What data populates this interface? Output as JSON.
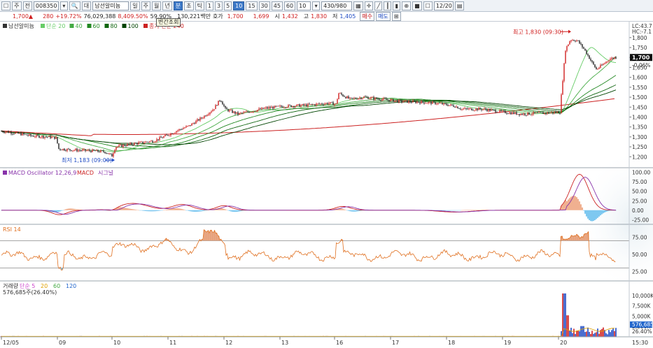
{
  "toolbar": {
    "items": [
      "주",
      "전",
      "대",
      "남선알미늄",
      "일",
      "주",
      "월",
      "년",
      "분",
      "초",
      "틱",
      "1",
      "3",
      "5",
      "10",
      "15",
      "30",
      "45",
      "60",
      "10",
      "430/980",
      "12/20"
    ],
    "active_index": 14
  },
  "ticker_code": "008350",
  "quote": {
    "price": "1,700▲",
    "change": "280",
    "change_pct": "+19.72%",
    "volume": "76,029,388",
    "vol_ratio": "8,409.50%",
    "turnover_ratio": "59.90%",
    "amount": "130,221백만",
    "bid_label": "호가",
    "bid": "1,700",
    "ask": "1,699",
    "open_label": "시",
    "open": "1,432",
    "high_label": "고",
    "high": "1,830",
    "low_label": "저",
    "low": "1,405",
    "buy_btn": "매수",
    "sell_btn": "매도"
  },
  "tooltip": "변간조회",
  "price_panel": {
    "legend": [
      "남선알미늄",
      "단순 20",
      "40",
      "60",
      "80",
      "100",
      "종가 단순 240"
    ],
    "legend_colors": [
      "#333333",
      "#66cc66",
      "#44aa44",
      "#228822",
      "#116611",
      "#004400",
      "#cc2222"
    ],
    "high_label": "최고 1,830 (09:30)",
    "low_label": "최저 1,183 (09:00)",
    "corner_info": [
      "LC:43.7",
      "HC:-7.1"
    ],
    "current_price": "1,700",
    "current_pct": "-0.06%",
    "y_ticks": [
      "1,800",
      "1,750",
      "1,700",
      "1,650",
      "1,600",
      "1,550",
      "1,500",
      "1,450",
      "1,400",
      "1,350",
      "1,300",
      "1,250",
      "1,200"
    ]
  },
  "macd_panel": {
    "legend": [
      "MACD Oscillator 12,26,9",
      "MACD",
      "시그널"
    ],
    "y_ticks": [
      "100.00",
      "75.00",
      "50.00",
      "25.00",
      "0.00",
      "-25.00"
    ]
  },
  "rsi_panel": {
    "legend": [
      "RSI 14"
    ],
    "y_ticks": [
      "75.00",
      "50.00",
      "25.00"
    ]
  },
  "volume_panel": {
    "legend": [
      "거래량",
      "단순 5",
      "20",
      "60",
      "120"
    ],
    "volume_info": "576,685주(26.40%)",
    "y_ticks": [
      "10,000K",
      "7,500K",
      "5,000K",
      "2,500K"
    ],
    "current_label": "576,685",
    "current_pct": "26.40%"
  },
  "x_axis": {
    "labels": [
      "12/05",
      "09",
      "10",
      "11",
      "12",
      "13",
      "16",
      "17",
      "18",
      "19",
      "20"
    ],
    "time": "15:30"
  },
  "colors": {
    "up": "#d02020",
    "down": "#1f4bc4",
    "candle": "#222222",
    "ma240": "#cc2222",
    "macd": "#cc2222",
    "signal": "#8833aa",
    "osc_pos": "#f0b090",
    "osc_neg": "#7ec8f0",
    "rsi": "#e07020",
    "rsi_fill": "#e6a07a"
  }
}
